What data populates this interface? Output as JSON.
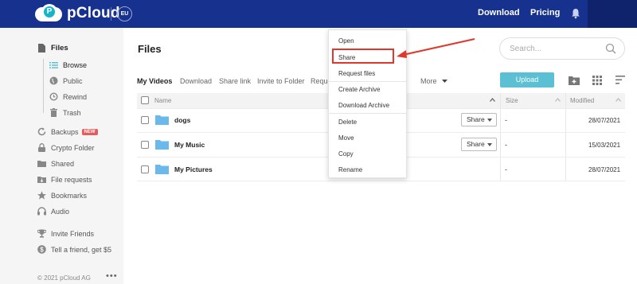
{
  "header": {
    "brand": "pCloud",
    "region": "EU",
    "nav": [
      "Download",
      "Pricing"
    ]
  },
  "sidebar": {
    "items": [
      {
        "label": "Files",
        "icon": "file-icon"
      },
      {
        "label": "Browse",
        "icon": "list-icon"
      },
      {
        "label": "Public",
        "icon": "globe-icon"
      },
      {
        "label": "Rewind",
        "icon": "rewind-icon"
      },
      {
        "label": "Trash",
        "icon": "trash-icon"
      },
      {
        "label": "Backups",
        "icon": "backup-icon",
        "badge": "NEW"
      },
      {
        "label": "Crypto Folder",
        "icon": "lock-icon"
      },
      {
        "label": "Shared",
        "icon": "shared-folder-icon"
      },
      {
        "label": "File requests",
        "icon": "file-request-icon"
      },
      {
        "label": "Bookmarks",
        "icon": "star-icon"
      },
      {
        "label": "Audio",
        "icon": "headphones-icon"
      },
      {
        "label": "Invite Friends",
        "icon": "trophy-icon"
      },
      {
        "label": "Tell a friend, get $5",
        "icon": "dollar-icon"
      }
    ],
    "footer": "© 2021 pCloud AG",
    "footer_more": "•••"
  },
  "main": {
    "title": "Files",
    "search_placeholder": "Search...",
    "toolbar": [
      "My Videos",
      "Download",
      "Share link",
      "Invite to Folder",
      "Reque"
    ],
    "more_label": "More",
    "upload_label": "Upload",
    "columns": {
      "name": "Name",
      "size": "Size",
      "modified": "Modified"
    },
    "rows": [
      {
        "name": "dogs",
        "share": "Share",
        "size": "-",
        "modified": "28/07/2021"
      },
      {
        "name": "My Music",
        "share": "Share",
        "size": "-",
        "modified": "15/03/2021"
      },
      {
        "name": "My Pictures",
        "share": "",
        "size": "-",
        "modified": "28/07/2021"
      }
    ]
  },
  "context_menu": {
    "items": [
      "Open",
      "Share",
      "Request files",
      "Create Archive",
      "Download Archive",
      "Delete",
      "Move",
      "Copy",
      "Rename"
    ],
    "highlighted": "Share"
  },
  "colors": {
    "header_bg": "#17318f",
    "accent": "#5bc0d3",
    "annotation": "#e0372c"
  }
}
